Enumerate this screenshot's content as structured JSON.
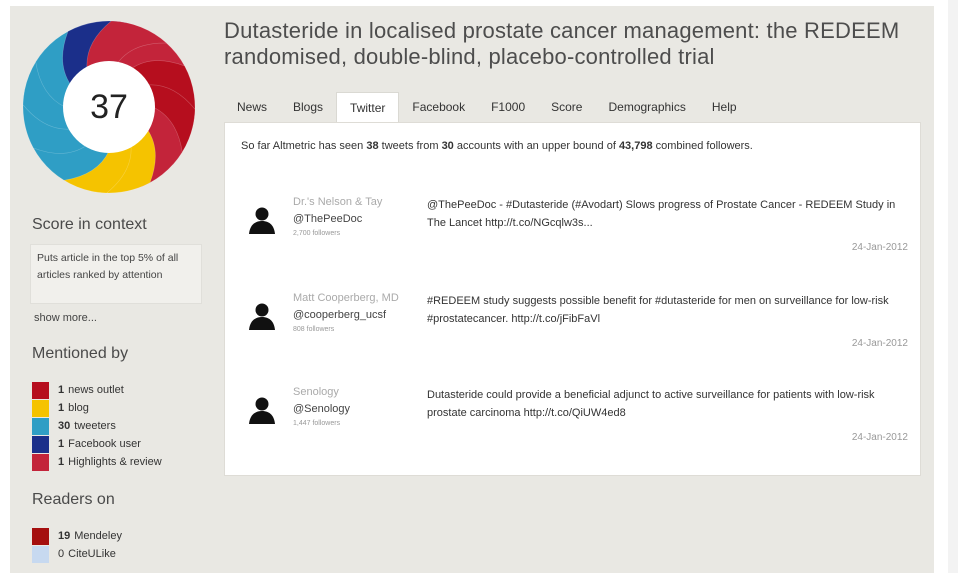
{
  "score": "37",
  "colors": {
    "background": "#e9e8e3",
    "panel": "#ffffff",
    "news": "#b60e1e",
    "blog": "#f5c300",
    "twitter": "#2f9ec5",
    "facebook": "#1b2f8a",
    "highlights": "#c3243a",
    "mendeley": "#a50f0f",
    "citeulike": "#c7d9f0"
  },
  "sidebar": {
    "score_in_context_heading": "Score in context",
    "score_in_context_text": "Puts article in the top 5% of all articles ranked by attention",
    "show_more": "show more...",
    "mentioned_by_heading": "Mentioned by",
    "mentioned_by": [
      {
        "count": "1",
        "label": "news outlet",
        "color": "#b60e1e"
      },
      {
        "count": "1",
        "label": "blog",
        "color": "#f5c300"
      },
      {
        "count": "30",
        "label": "tweeters",
        "color": "#2f9ec5"
      },
      {
        "count": "1",
        "label": "Facebook user",
        "color": "#1b2f8a"
      },
      {
        "count": "1",
        "label": "Highlights & review",
        "color": "#c3243a"
      }
    ],
    "readers_on_heading": "Readers on",
    "readers_on": [
      {
        "count": "19",
        "label": "Mendeley",
        "color": "#a50f0f"
      },
      {
        "count": "0",
        "label": "CiteULike",
        "color": "#c7d9f0"
      }
    ]
  },
  "article": {
    "title": "Dutasteride in localised prostate cancer management: the REDEEM randomised, double-blind, placebo-controlled trial"
  },
  "tabs": [
    {
      "label": "News"
    },
    {
      "label": "Blogs"
    },
    {
      "label": "Twitter",
      "active": true
    },
    {
      "label": "Facebook"
    },
    {
      "label": "F1000"
    },
    {
      "label": "Score"
    },
    {
      "label": "Demographics"
    },
    {
      "label": "Help"
    }
  ],
  "summary": {
    "prefix": "So far Altmetric has seen ",
    "tweets": "38",
    "mid1": " tweets from ",
    "accounts": "30",
    "mid2": " accounts with an upper bound of ",
    "followers": "43,798",
    "suffix": " combined followers."
  },
  "tweets": [
    {
      "name": "Dr.'s Nelson & Tay",
      "handle": "@ThePeeDoc",
      "followers": "2,700 followers",
      "text": "@ThePeeDoc - #Dutasteride (#Avodart) Slows progress of Prostate Cancer - REDEEM Study in The Lancet http://t.co/NGcqlw3s...",
      "date": "24-Jan-2012"
    },
    {
      "name": "Matt Cooperberg, MD",
      "handle": "@cooperberg_ucsf",
      "followers": "808 followers",
      "text": "#REDEEM study suggests possible benefit for #dutasteride for men on surveillance for low-risk #prostatecancer. http://t.co/jFibFaVl",
      "date": "24-Jan-2012"
    },
    {
      "name": "Senology",
      "handle": "@Senology",
      "followers": "1,447 followers",
      "text": "Dutasteride could provide a beneficial adjunct to active surveillance for patients with low-risk prostate carcinoma http://t.co/QiUW4ed8",
      "date": "24-Jan-2012"
    }
  ]
}
